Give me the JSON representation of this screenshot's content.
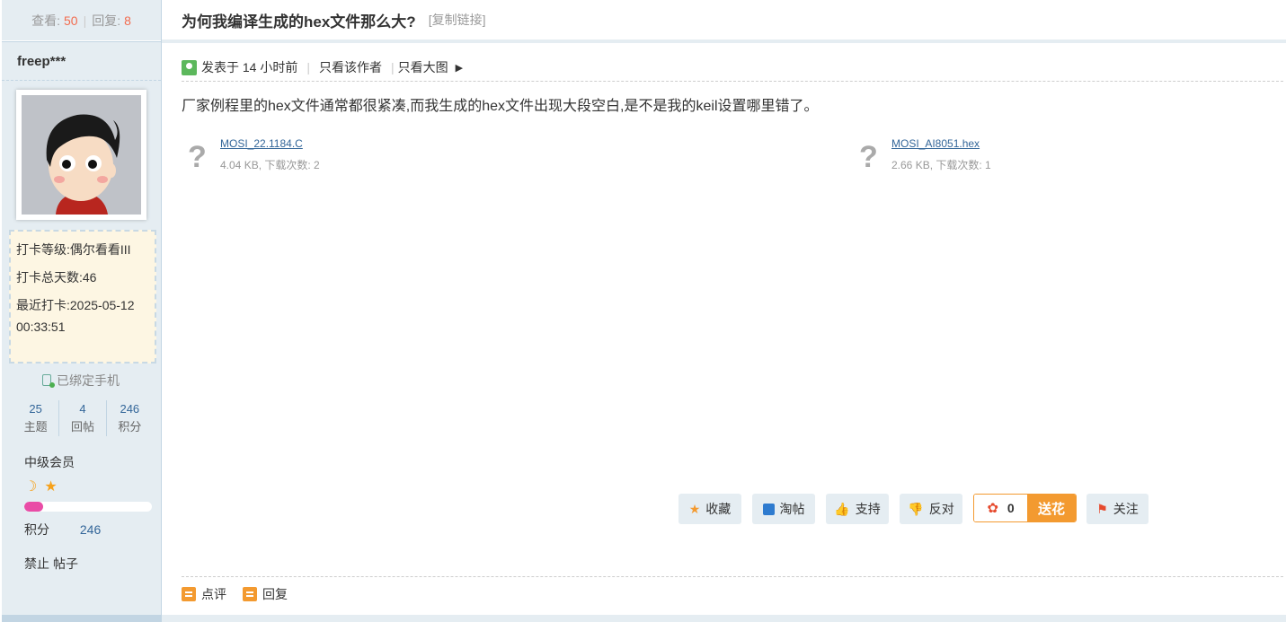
{
  "sidebar": {
    "stats": {
      "views_label": "查看:",
      "views": "50",
      "replies_label": "回复:",
      "replies": "8"
    },
    "username": "freep***",
    "checkin": {
      "level": "打卡等级:偶尔看看III",
      "days": "打卡总天数:46",
      "last": "最近打卡:2025-05-12 00:33:51"
    },
    "phone_bound": "已绑定手机",
    "counts": [
      {
        "value": "25",
        "label": "主题"
      },
      {
        "value": "4",
        "label": "回帖"
      },
      {
        "value": "246",
        "label": "积分"
      }
    ],
    "level": "中级会员",
    "progress_fraction": 0.15,
    "points_label": "积分",
    "points_value": "246",
    "ban_1": "禁止",
    "ban_2": "帖子"
  },
  "thread": {
    "title": "为何我编译生成的hex文件那么大?",
    "copy_link": "[复制链接]"
  },
  "meta": {
    "posted": "发表于 14 小时前",
    "only_author": "只看该作者",
    "big_image": "只看大图"
  },
  "post": {
    "text": "厂家例程里的hex文件通常都很紧凑,而我生成的hex文件出现大段空白,是不是我的keil设置哪里错了。"
  },
  "attachments": [
    {
      "name": "MOSI_22.1184.C",
      "info": "4.04 KB, 下载次数: 2"
    },
    {
      "name": "MOSI_AI8051.hex",
      "info": "2.66 KB, 下载次数: 1"
    }
  ],
  "actions": {
    "favorite": "收藏",
    "tao": "淘帖",
    "support": "支持",
    "oppose": "反对",
    "flower_count": "0",
    "send_flower": "送花",
    "follow": "关注"
  },
  "footer": {
    "comment": "点评",
    "reply": "回复"
  },
  "colors": {
    "accent": "#f39a30",
    "link": "#336699",
    "sidebar_bg": "#e5edf2",
    "count_red": "#f26c4f"
  }
}
